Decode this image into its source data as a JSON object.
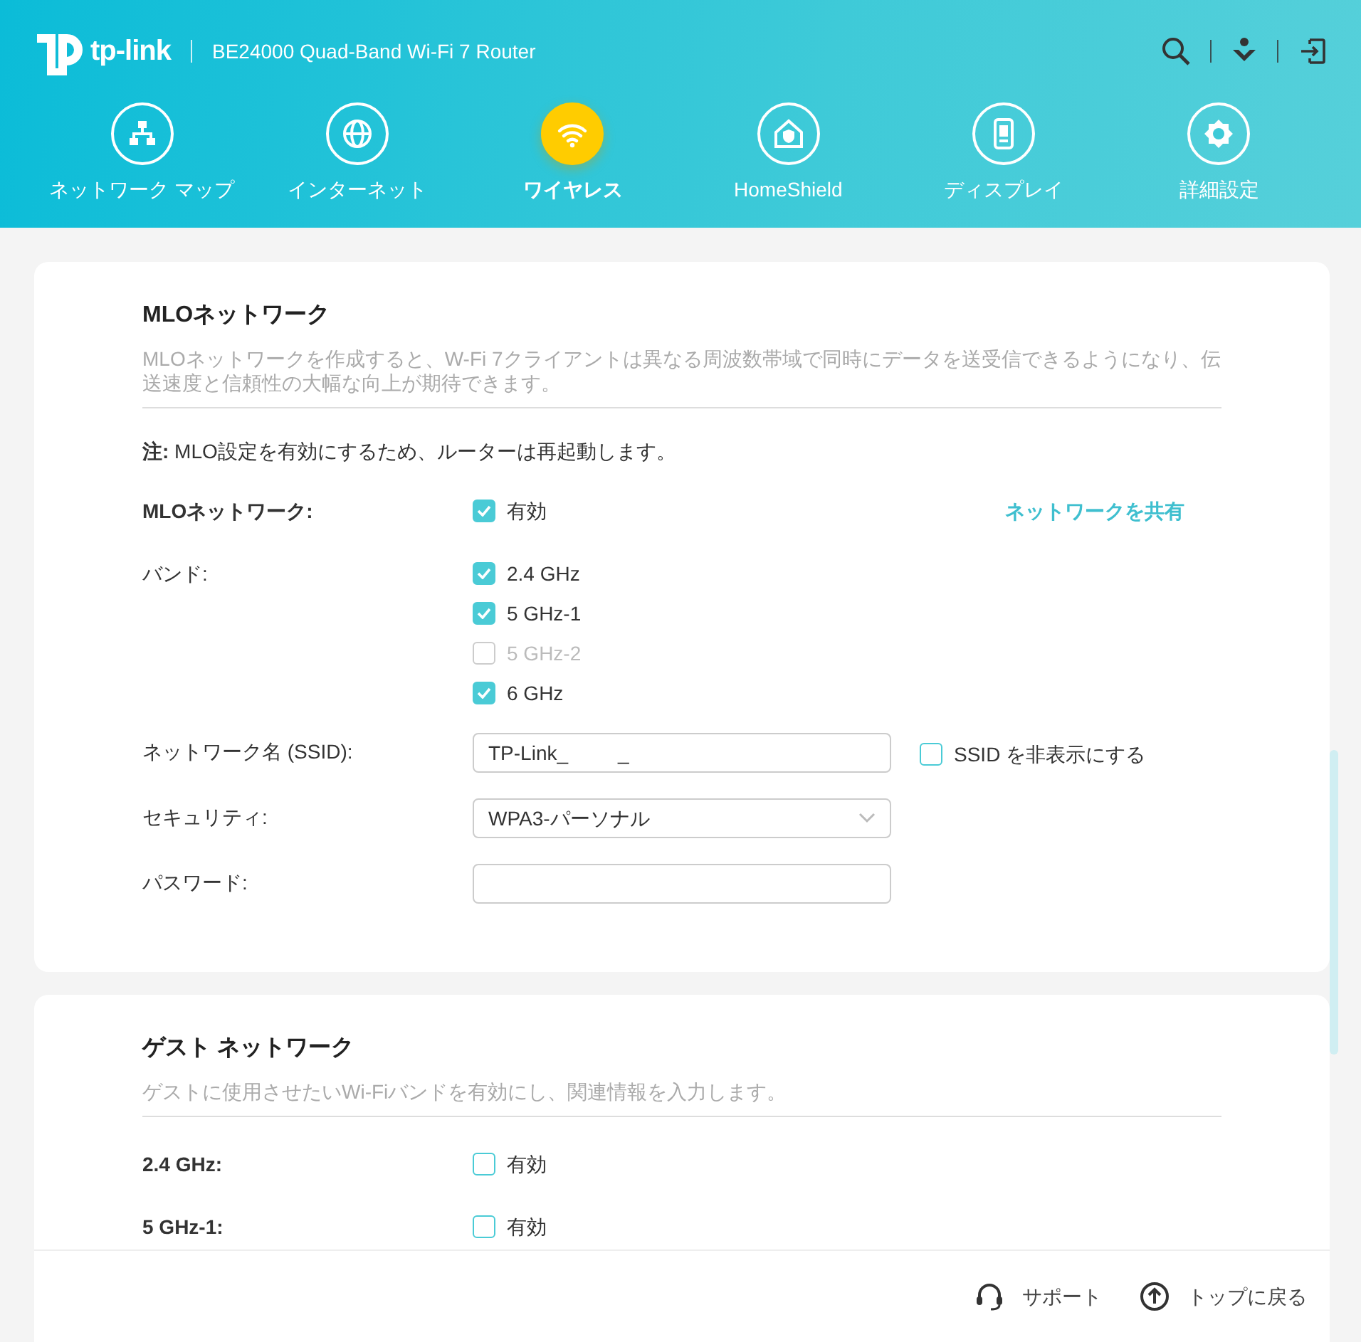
{
  "header": {
    "logo": "tp-link",
    "model": "BE24000 Quad-Band Wi-Fi 7 Router"
  },
  "nav": [
    {
      "kind": "map",
      "label": "ネットワーク マップ",
      "selected": false
    },
    {
      "kind": "globe",
      "label": "インターネット",
      "selected": false
    },
    {
      "kind": "wifi",
      "label": "ワイヤレス",
      "selected": true
    },
    {
      "kind": "shield",
      "label": "HomeShield",
      "selected": false
    },
    {
      "kind": "display",
      "label": "ディスプレイ",
      "selected": false
    },
    {
      "kind": "gear",
      "label": "詳細設定",
      "selected": false
    }
  ],
  "mlo": {
    "title": "MLOネットワーク",
    "description": "MLOネットワークを作成すると、W-Fi 7クライアントは異なる周波数帯域で同時にデータを送受信できるようになり、伝送速度と信頼性の大幅な向上が期待できます。",
    "note": "**注:** MLO設定を有効にするため、ルーターは再起動します。",
    "rows": [
      {
        "kind": "checkbox",
        "label": "MLOネットワーク:",
        "options": [
          {
            "label": "有効",
            "checked": true,
            "disabled": false
          }
        ],
        "link": "ネットワークを共有"
      },
      {
        "kind": "checkbox",
        "label": "バンド:",
        "options": [
          {
            "label": "2.4 GHz",
            "checked": true,
            "disabled": false
          },
          {
            "label": "5 GHz-1",
            "checked": true,
            "disabled": false
          },
          {
            "label": "5 GHz-2",
            "checked": false,
            "disabled": true
          },
          {
            "label": "6 GHz",
            "checked": true,
            "disabled": false
          }
        ]
      },
      {
        "kind": "text",
        "label": "ネットワーク名 (SSID):",
        "value": "TP-Link_         _",
        "side": {
          "label": "SSID を非表示にする",
          "checked": false
        }
      },
      {
        "kind": "select",
        "label": "セキュリティ:",
        "value": "WPA3-パーソナル"
      },
      {
        "kind": "password",
        "label": "パスワード:"
      }
    ]
  },
  "guest": {
    "title": "ゲスト ネットワーク",
    "description": "ゲストに使用させたいWi-Fiバンドを有効にし、関連情報を入力します。",
    "rows": [
      {
        "kind": "checkbox",
        "label": "2.4 GHz:",
        "options": [
          {
            "label": "有効",
            "checked": false,
            "disabled": false
          }
        ]
      },
      {
        "kind": "checkbox",
        "label": "5 GHz-1:",
        "options": [
          {
            "label": "有効",
            "checked": false,
            "disabled": false
          }
        ]
      }
    ]
  },
  "footer": {
    "support": "サポート",
    "back_to_top": "トップに戻る"
  }
}
